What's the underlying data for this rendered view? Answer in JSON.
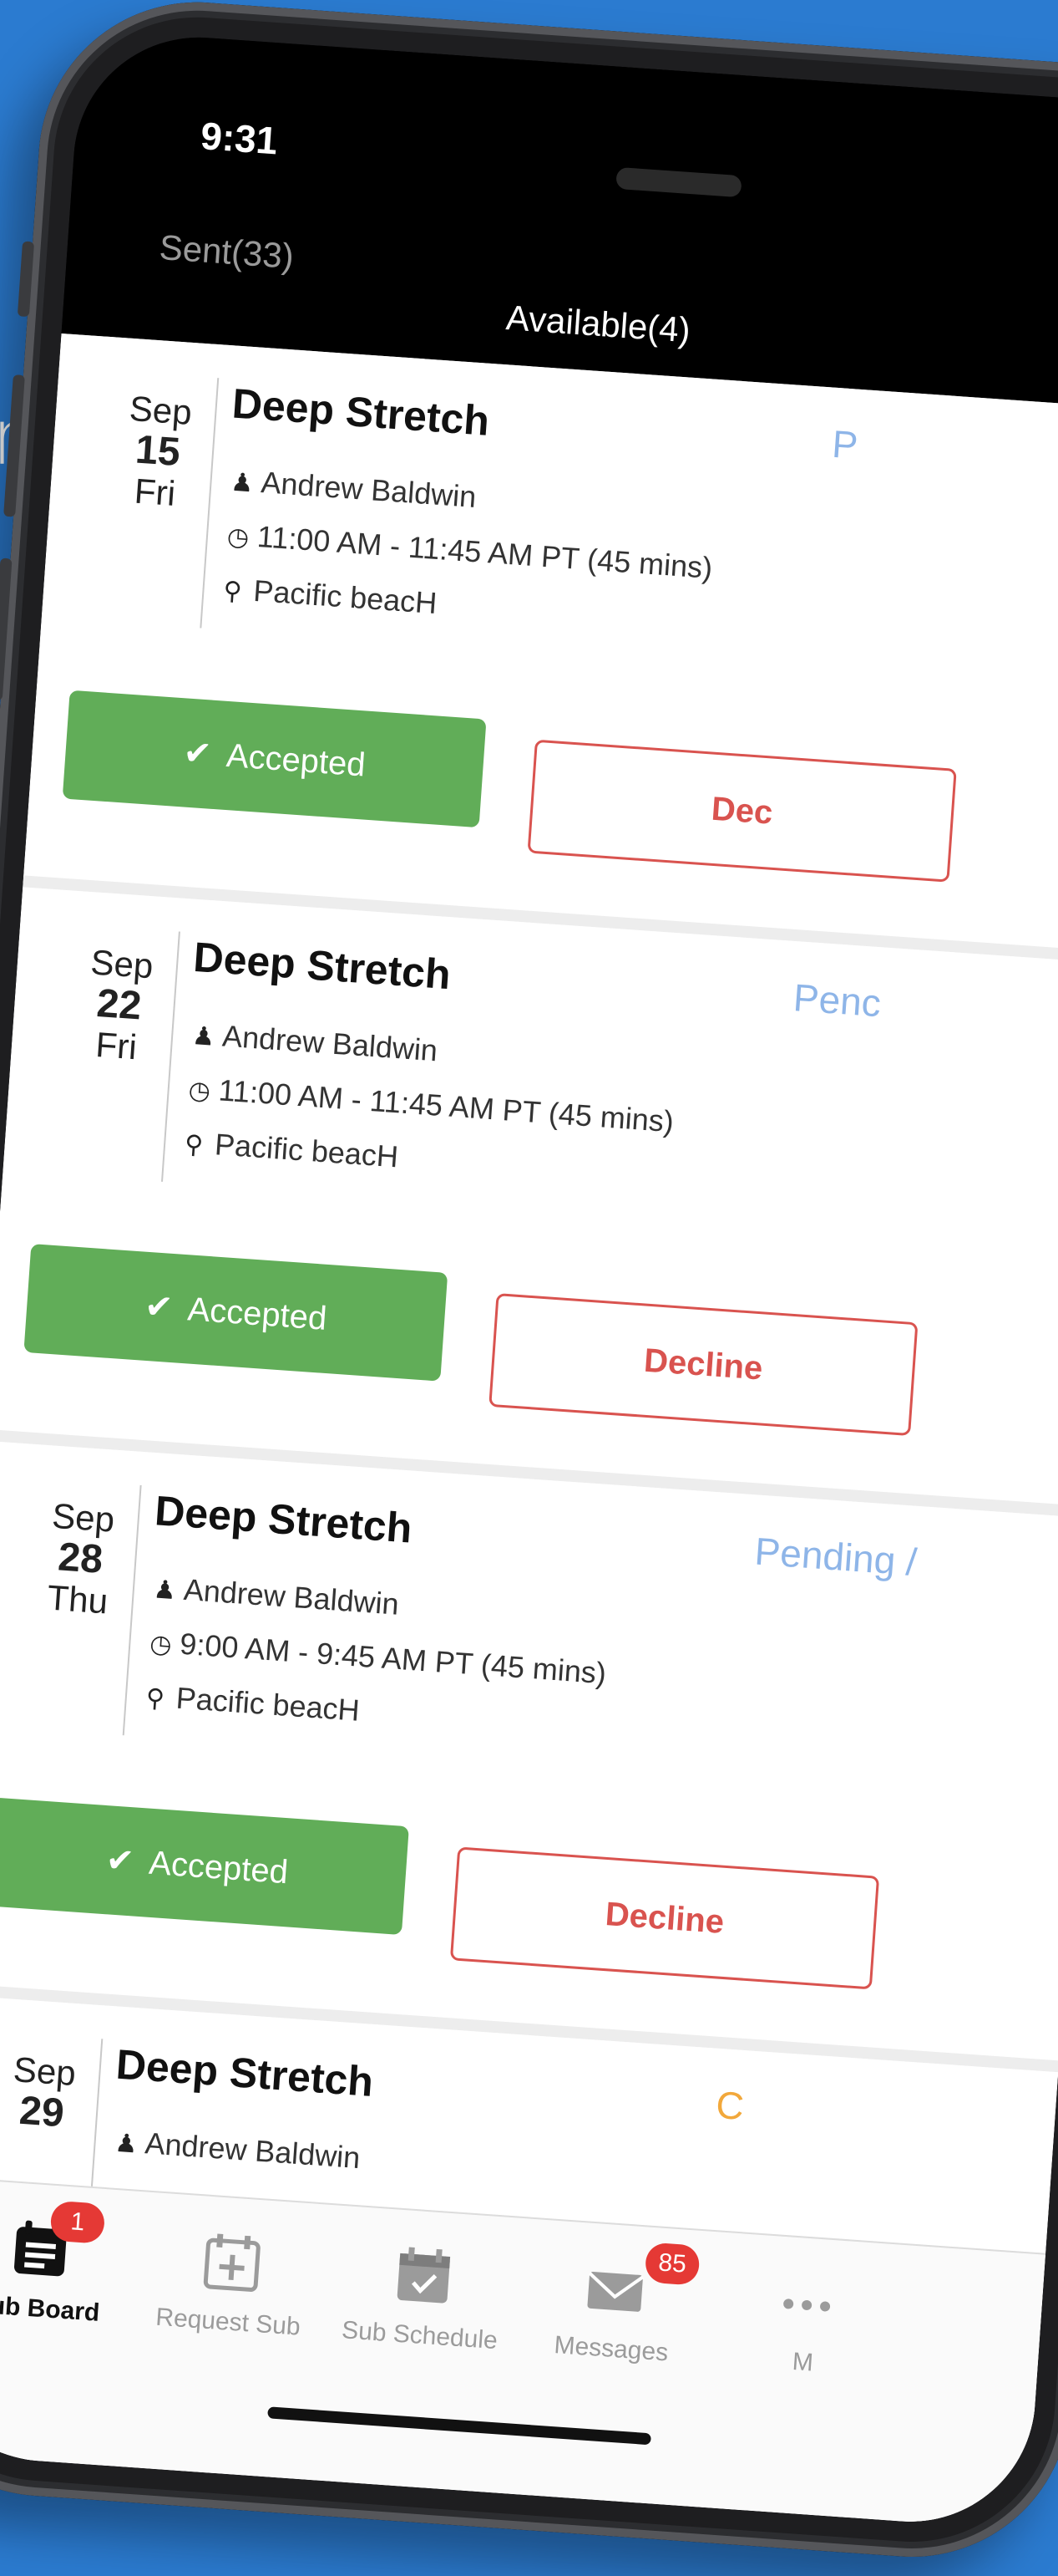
{
  "side_text": "n",
  "status_bar": {
    "time": "9:31"
  },
  "tabs": {
    "sent": "Sent(33)",
    "available": "Available(4)"
  },
  "cards": [
    {
      "month": "Sep",
      "day": "15",
      "weekday": "Fri",
      "title": "Deep Stretch",
      "instructor": "Andrew Baldwin",
      "time": "11:00 AM - 11:45 AM PT (45 mins)",
      "location": "Pacific beacH",
      "status": "P",
      "accept_label": "Accepted",
      "decline_label": "Dec"
    },
    {
      "month": "Sep",
      "day": "22",
      "weekday": "Fri",
      "title": "Deep Stretch",
      "instructor": "Andrew Baldwin",
      "time": "11:00 AM - 11:45 AM PT (45 mins)",
      "location": "Pacific beacH",
      "status": "Penc",
      "accept_label": "Accepted",
      "decline_label": "Decline"
    },
    {
      "month": "Sep",
      "day": "28",
      "weekday": "Thu",
      "title": "Deep Stretch",
      "instructor": "Andrew Baldwin",
      "time": "9:00 AM -  9:45 AM PT (45 mins)",
      "location": "Pacific beacH",
      "status": "Pending /",
      "accept_label": "Accepted",
      "decline_label": "Decline"
    },
    {
      "month": "Sep",
      "day": "29",
      "weekday": "",
      "title": "Deep Stretch",
      "instructor": "Andrew Baldwin",
      "time": "",
      "location": "",
      "status": "C",
      "accept_label": "",
      "decline_label": ""
    }
  ],
  "tabbar": {
    "sub_board": "Sub Board",
    "sub_board_badge": "1",
    "request_sub": "Request Sub",
    "sub_schedule": "Sub Schedule",
    "messages": "Messages",
    "messages_badge": "85",
    "more": "M"
  },
  "colors": {
    "background": "#2b7bd0",
    "accept": "#61ad58",
    "decline": "#d9534f",
    "pending": "#8eb5e8",
    "badge": "#e53935"
  }
}
